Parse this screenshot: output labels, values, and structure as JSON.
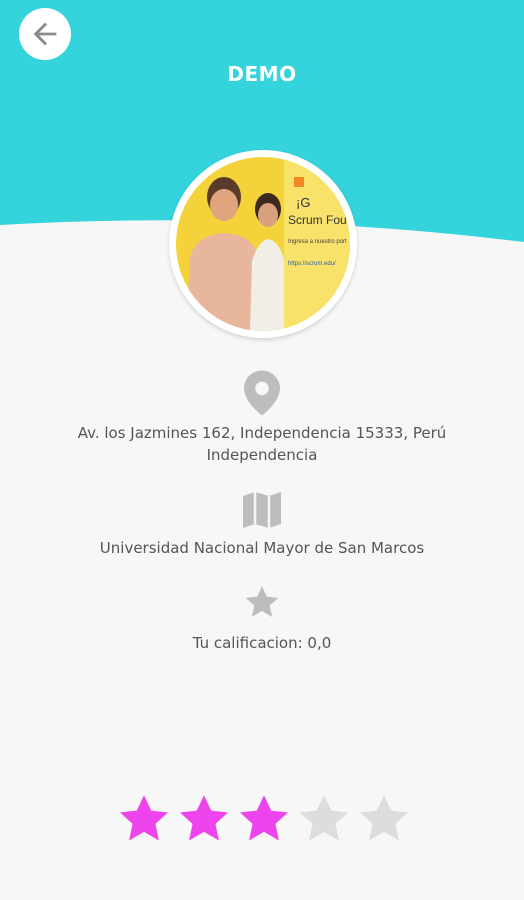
{
  "header": {
    "title": "DEMO",
    "color": "#35d4dc"
  },
  "location": {
    "address_line1": "Av. los Jazmines 162, Independencia 15333, Perú",
    "address_line2": "Independencia"
  },
  "institution": {
    "name": "Universidad Nacional Mayor de San Marcos"
  },
  "rating": {
    "label": "Tu calificacion: 0,0",
    "stars_filled": 3,
    "stars_total": 5,
    "filled_color": "#ee44ee",
    "empty_color": "#dddddd"
  },
  "avatar": {
    "text_line1": "¡G",
    "text_line2": "Scrum Foun",
    "text_line3": "Ingresa a nuestro port",
    "text_line4": "https://scrum.edu/"
  },
  "icons": {
    "back": "arrow-left-icon",
    "location": "map-pin-icon",
    "map": "map-icon",
    "star": "star-icon"
  }
}
